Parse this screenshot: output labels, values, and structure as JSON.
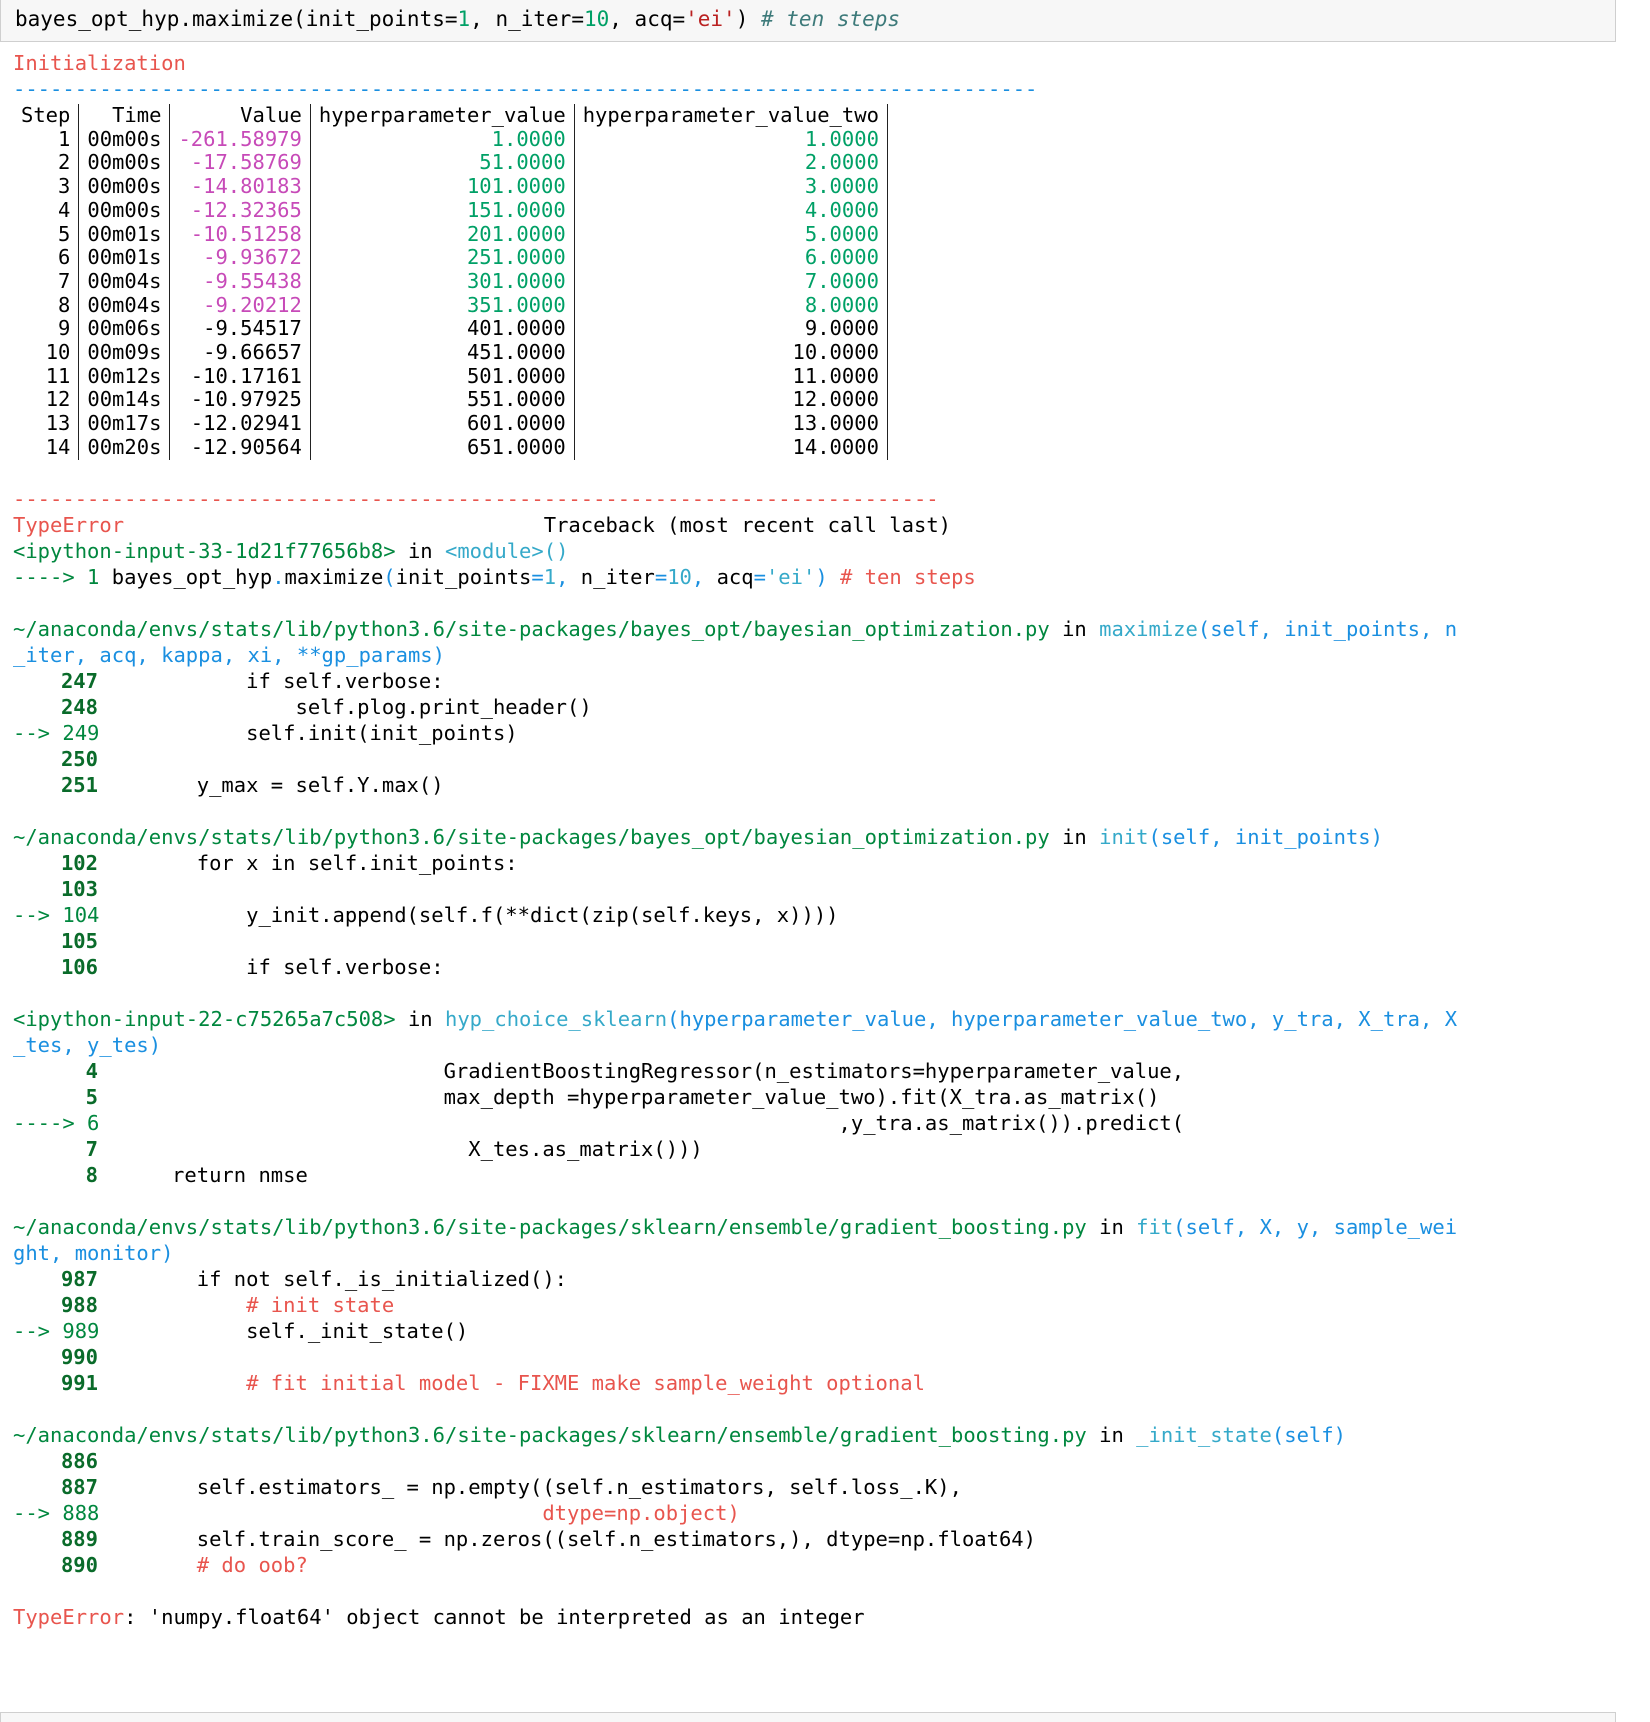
{
  "input": {
    "code_prefix": "bayes_opt_hyp.maximize(init_points=",
    "n1": "1",
    "code_mid1": ", n_iter=",
    "n2": "10",
    "code_mid2": ", acq=",
    "str": "'ei'",
    "code_mid3": ") ",
    "comment": "# ten steps"
  },
  "output": {
    "init_title": "Initialization",
    "blue_rule": "-----------------------------------------------------------------------------------",
    "table": {
      "headers": [
        "Step",
        "Time",
        "Value",
        "hyperparameter_value",
        "hyperparameter_value_two"
      ],
      "rows": [
        {
          "step": "1",
          "time": "00m00s",
          "value": "-261.58979",
          "hv": "1.0000",
          "hv2": "1.0000",
          "hl": true
        },
        {
          "step": "2",
          "time": "00m00s",
          "value": "-17.58769",
          "hv": "51.0000",
          "hv2": "2.0000",
          "hl": true
        },
        {
          "step": "3",
          "time": "00m00s",
          "value": "-14.80183",
          "hv": "101.0000",
          "hv2": "3.0000",
          "hl": true
        },
        {
          "step": "4",
          "time": "00m00s",
          "value": "-12.32365",
          "hv": "151.0000",
          "hv2": "4.0000",
          "hl": true
        },
        {
          "step": "5",
          "time": "00m01s",
          "value": "-10.51258",
          "hv": "201.0000",
          "hv2": "5.0000",
          "hl": true
        },
        {
          "step": "6",
          "time": "00m01s",
          "value": "-9.93672",
          "hv": "251.0000",
          "hv2": "6.0000",
          "hl": true
        },
        {
          "step": "7",
          "time": "00m04s",
          "value": "-9.55438",
          "hv": "301.0000",
          "hv2": "7.0000",
          "hl": true
        },
        {
          "step": "8",
          "time": "00m04s",
          "value": "-9.20212",
          "hv": "351.0000",
          "hv2": "8.0000",
          "hl": true
        },
        {
          "step": "9",
          "time": "00m06s",
          "value": "-9.54517",
          "hv": "401.0000",
          "hv2": "9.0000",
          "hl": false
        },
        {
          "step": "10",
          "time": "00m09s",
          "value": "-9.66657",
          "hv": "451.0000",
          "hv2": "10.0000",
          "hl": false
        },
        {
          "step": "11",
          "time": "00m12s",
          "value": "-10.17161",
          "hv": "501.0000",
          "hv2": "11.0000",
          "hl": false
        },
        {
          "step": "12",
          "time": "00m14s",
          "value": "-10.97925",
          "hv": "551.0000",
          "hv2": "12.0000",
          "hl": false
        },
        {
          "step": "13",
          "time": "00m17s",
          "value": "-12.02941",
          "hv": "601.0000",
          "hv2": "13.0000",
          "hl": false
        },
        {
          "step": "14",
          "time": "00m20s",
          "value": "-12.90564",
          "hv": "651.0000",
          "hv2": "14.0000",
          "hl": false
        }
      ]
    },
    "red_rule": "---------------------------------------------------------------------------",
    "error_name": "TypeError",
    "traceback_label": "Traceback (most recent call last)",
    "tb1": {
      "input_ref": "<ipython-input-33-1d21f77656b8>",
      "in": " in ",
      "module": "<module>()",
      "arrow": "----> 1",
      "code_a": " bayes_opt_hyp",
      "code_b": "maximize",
      "code_c": "init_points",
      "n1": "1",
      "code_d": "n_iter",
      "n2": "10",
      "code_e": "acq",
      "str": "'ei'",
      "comment": "# ten steps"
    },
    "tb2": {
      "path": "~/anaconda/envs/stats/lib/python3.6/site-packages/bayes_opt/bayesian_optimization.py",
      "func": "maximize",
      "sig_line1": "(self, init_points, n",
      "sig_line2": "_iter, acq, kappa, xi, **gp_params)",
      "lines": [
        {
          "no": "247",
          "code": "            if self.verbose:"
        },
        {
          "no": "248",
          "code": "                self.plog.print_header()"
        },
        {
          "no": "--> 249",
          "code": "            self.init(init_points)"
        },
        {
          "no": "250",
          "code": ""
        },
        {
          "no": "251",
          "code": "        y_max = self.Y.max()"
        }
      ]
    },
    "tb3": {
      "path": "~/anaconda/envs/stats/lib/python3.6/site-packages/bayes_opt/bayesian_optimization.py",
      "func": "init",
      "sig": "(self, init_points)",
      "lines": [
        {
          "no": "102",
          "code": "        for x in self.init_points:"
        },
        {
          "no": "103",
          "code": ""
        },
        {
          "no": "--> 104",
          "code": "            y_init.append(self.f(**dict(zip(self.keys, x))))"
        },
        {
          "no": "105",
          "code": ""
        },
        {
          "no": "106",
          "code": "            if self.verbose:"
        }
      ]
    },
    "tb4": {
      "input_ref": "<ipython-input-22-c75265a7c508>",
      "func": "hyp_choice_sklearn",
      "sig_line1": "(hyperparameter_value, hyperparameter_value_two, y_tra, X_tra, X",
      "sig_line2": "_tes, y_tes)",
      "lines": [
        {
          "no": "4",
          "code": "                            GradientBoostingRegressor(n_estimators=hyperparameter_value,"
        },
        {
          "no": "5",
          "code": "                            max_depth =hyperparameter_value_two).fit(X_tra.as_matrix()"
        },
        {
          "no": "----> 6",
          "code": "                                                            ,y_tra.as_matrix()).predict("
        },
        {
          "no": "7",
          "code": "                              X_tes.as_matrix()))"
        },
        {
          "no": "8",
          "code": "      return nmse"
        }
      ]
    },
    "tb5": {
      "path": "~/anaconda/envs/stats/lib/python3.6/site-packages/sklearn/ensemble/gradient_boosting.py",
      "func": "fit",
      "sig_line1": "(self, X, y, sample_wei",
      "sig_line2": "ght, monitor)",
      "lines": [
        {
          "no": "987",
          "code": "        if not self._is_initialized():"
        },
        {
          "no": "988",
          "code": "            # init state"
        },
        {
          "no": "--> 989",
          "code": "            self._init_state()"
        },
        {
          "no": "990",
          "code": ""
        },
        {
          "no": "991",
          "code": "            # fit initial model - FIXME make sample_weight optional"
        }
      ]
    },
    "tb6": {
      "path": "~/anaconda/envs/stats/lib/python3.6/site-packages/sklearn/ensemble/gradient_boosting.py",
      "func": "_init_state",
      "sig": "(self)",
      "lines": [
        {
          "no": "886",
          "code": ""
        },
        {
          "no": "887",
          "code": "        self.estimators_ = np.empty((self.n_estimators, self.loss_.K),"
        },
        {
          "no": "--> 888",
          "code": "                                    dtype=np.object)"
        },
        {
          "no": "889",
          "code": "        self.train_score_ = np.zeros((self.n_estimators,), dtype=np.float64)"
        },
        {
          "no": "890",
          "code": "        # do oob?"
        }
      ]
    },
    "final_error_name": "TypeError",
    "final_error_msg": ": 'numpy.float64' object cannot be interpreted as an integer"
  }
}
